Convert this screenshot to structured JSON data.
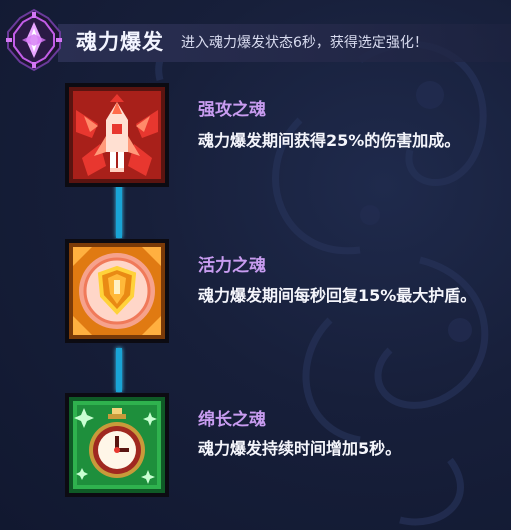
{
  "header": {
    "title": "魂力爆发",
    "subtitle": "进入魂力爆发状态6秒，获得选定强化！"
  },
  "skills": [
    {
      "name": "强攻之魂",
      "desc": "魂力爆发期间获得25%的伤害加成。",
      "icon": "rocket-icon",
      "accent": "#e8372f"
    },
    {
      "name": "活力之魂",
      "desc": "魂力爆发期间每秒回复15%最大护盾。",
      "icon": "shield-icon",
      "accent": "#f08a1e"
    },
    {
      "name": "绵长之魂",
      "desc": "魂力爆发持续时间增加5秒。",
      "icon": "stopwatch-icon",
      "accent": "#2fc35a"
    }
  ],
  "colors": {
    "background": "#171f3a",
    "skill_name": "#c89cf0",
    "connector": "#19a4d6"
  }
}
